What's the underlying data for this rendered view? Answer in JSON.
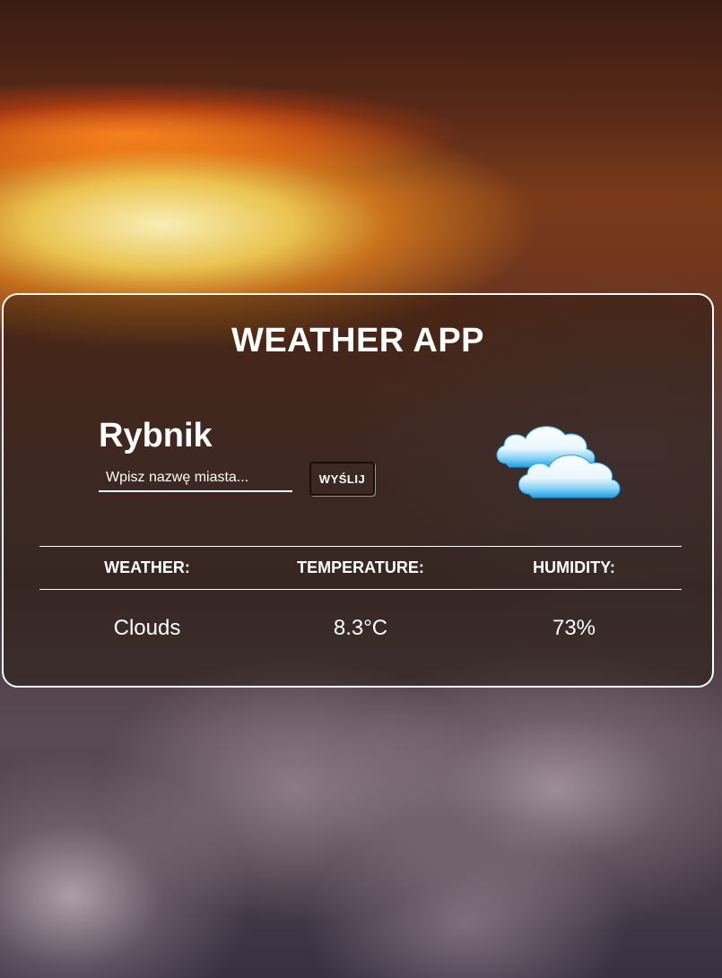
{
  "app": {
    "title": "WEATHER APP"
  },
  "location": {
    "city": "Rybnik"
  },
  "search": {
    "placeholder": "Wpisz nazwę miasta...",
    "value": "",
    "button_label": "WYŚLIJ"
  },
  "weather_icon": "cloud-icon",
  "info": {
    "headers": [
      "WEATHER:",
      "TEMPERATURE:",
      "HUMIDITY:"
    ],
    "values": [
      "Clouds",
      "8.3°C",
      "73%"
    ]
  },
  "colors": {
    "text": "#ffffff",
    "card_border": "#ffffff",
    "cloud_top": "#ffffff",
    "cloud_bottom": "#29a8ea"
  }
}
